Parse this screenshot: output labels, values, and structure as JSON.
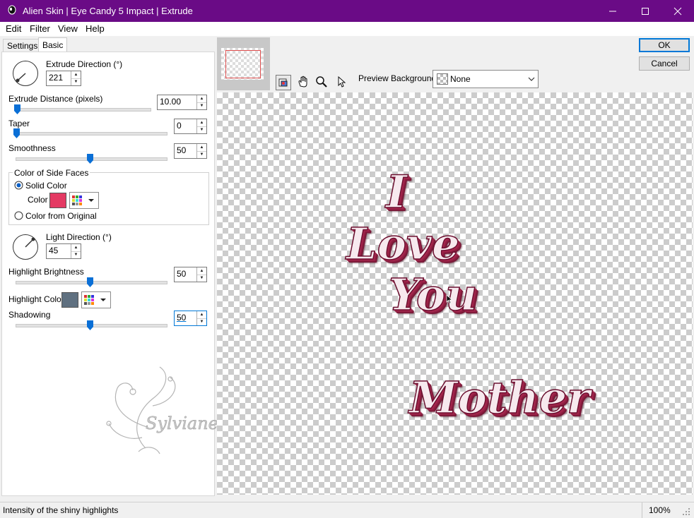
{
  "window": {
    "title": "Alien Skin | Eye Candy 5 Impact | Extrude",
    "title_bar_color": "#6a0b86"
  },
  "menu": {
    "items": [
      "Edit",
      "Filter",
      "View",
      "Help"
    ]
  },
  "tabs": [
    {
      "label": "Settings",
      "active": false
    },
    {
      "label": "Basic",
      "active": true
    }
  ],
  "controls": {
    "extrude_direction": {
      "label": "Extrude Direction (°)",
      "value": "221"
    },
    "extrude_distance": {
      "label": "Extrude Distance (pixels)",
      "value": "10.00"
    },
    "taper": {
      "label": "Taper",
      "value": "0"
    },
    "smoothness": {
      "label": "Smoothness",
      "value": "50"
    },
    "side_faces": {
      "group_label": "Color of Side Faces",
      "solid_color_label": "Solid Color",
      "color_label": "Color",
      "color": "#e43a63",
      "from_original_label": "Color from Original",
      "selected": "Solid Color"
    },
    "light_direction": {
      "label": "Light Direction (°)",
      "value": "45"
    },
    "highlight_brightness": {
      "label": "Highlight Brightness",
      "value": "50"
    },
    "highlight_color": {
      "label": "Highlight Color",
      "color": "#5f7080"
    },
    "shadowing": {
      "label": "Shadowing",
      "value": "50"
    }
  },
  "watermark": {
    "text": "Sylviane"
  },
  "preview": {
    "background_label": "Preview Background:",
    "background_value": "None",
    "words": [
      "I",
      "Love",
      "You",
      "Mother"
    ],
    "tools": [
      "navigator-icon",
      "hand-icon",
      "zoom-icon",
      "pointer-icon"
    ]
  },
  "buttons": {
    "ok": "OK",
    "cancel": "Cancel"
  },
  "status": {
    "text": "Intensity of the shiny highlights",
    "zoom": "100%"
  }
}
